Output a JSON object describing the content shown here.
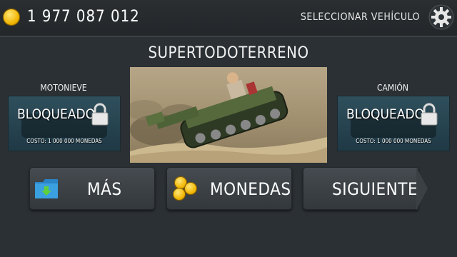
{
  "header": {
    "coin_icon": "gold-coin-icon",
    "coins": "1 977 087 012",
    "select_label": "SELECCIONAR VEHÍCULO",
    "settings_icon": "gear-icon"
  },
  "selected_vehicle": {
    "name": "SUPERTODOTERRENO"
  },
  "left_vehicle": {
    "name": "MOTONIEVE",
    "status": "BLOQUEADO",
    "cost": "COSTO: 1 000 000 MONEDAS"
  },
  "right_vehicle": {
    "name": "CAMIÓN",
    "status": "BLOQUEADO",
    "cost": "COSTO: 1 000 000 MONEDAS"
  },
  "buttons": {
    "more": "MÁS",
    "coins": "MONEDAS",
    "next": "SIGUIENTE"
  },
  "colors": {
    "background": "#2b3034",
    "button": "#3d4347",
    "coin": "#f0b400"
  }
}
